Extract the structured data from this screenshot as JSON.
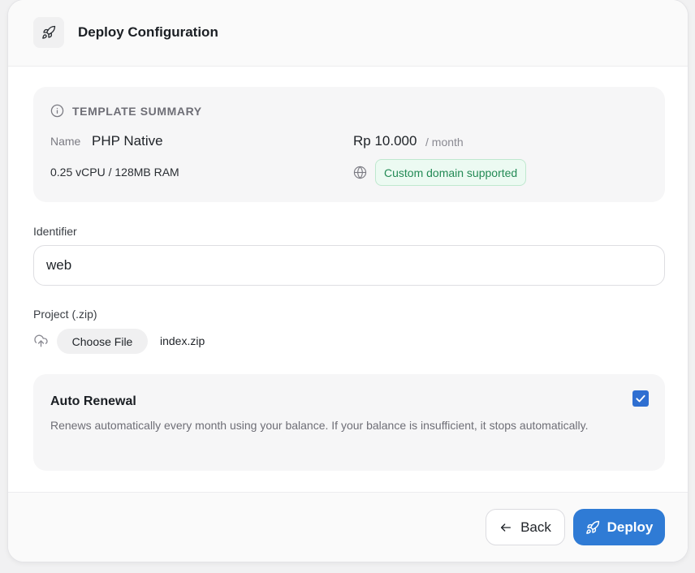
{
  "header": {
    "title": "Deploy Configuration",
    "icon": "rocket-icon"
  },
  "summary": {
    "title": "TEMPLATE SUMMARY",
    "name_label": "Name",
    "name_value": "PHP Native",
    "price_value": "Rp 10.000",
    "price_unit": "/ month",
    "specs": "0.25 vCPU / 128MB RAM",
    "badge": "Custom domain supported"
  },
  "identifier": {
    "label": "Identifier",
    "value": "web"
  },
  "project": {
    "label": "Project (.zip)",
    "button": "Choose File",
    "file_name": "index.zip"
  },
  "renewal": {
    "title": "Auto Renewal",
    "description": "Renews automatically every month using your balance. If your balance is insufficient, it stops automatically.",
    "checked": true
  },
  "footer": {
    "back_label": "Back",
    "deploy_label": "Deploy"
  },
  "colors": {
    "accent": "#2f7bd5",
    "badge_text": "#238a55",
    "badge_bg": "#ecfaf2"
  }
}
